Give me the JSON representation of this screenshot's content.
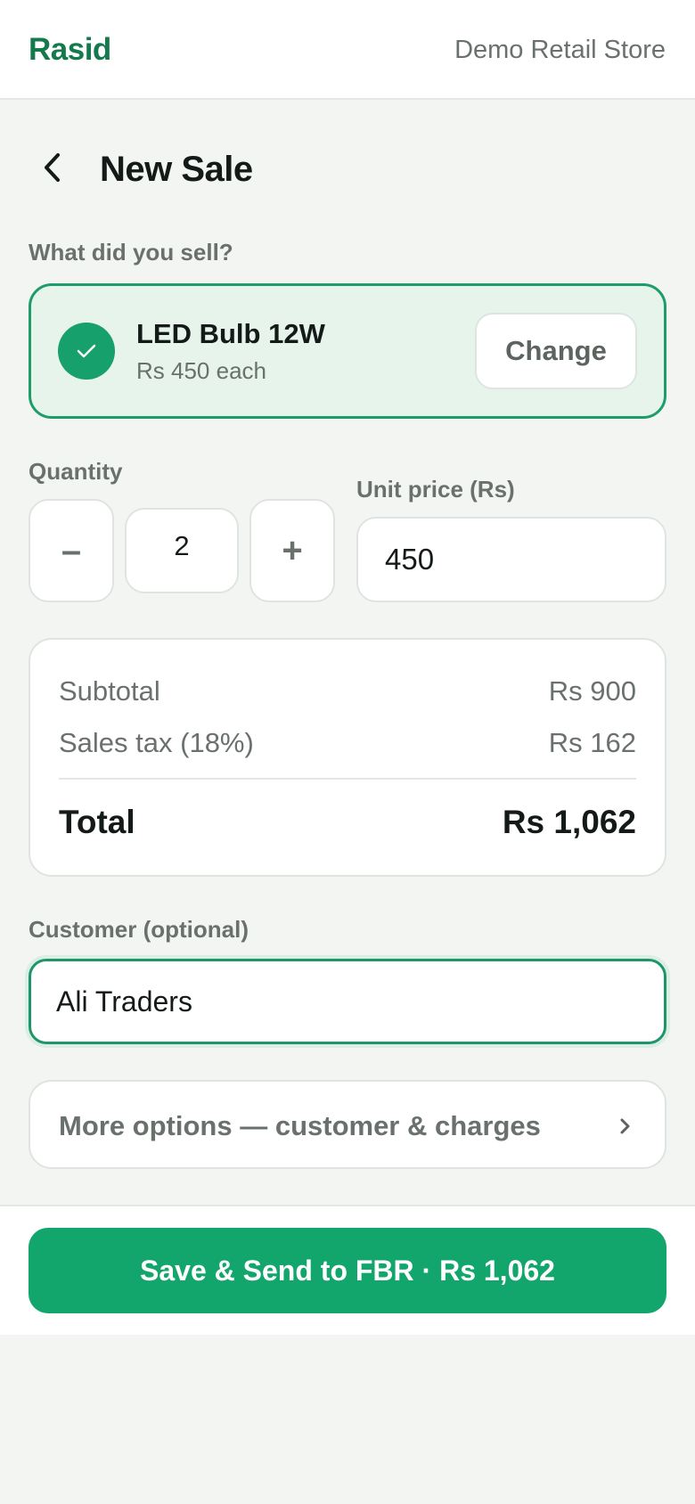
{
  "header": {
    "brand": "Rasid",
    "store": "Demo Retail Store"
  },
  "page": {
    "title": "New Sale"
  },
  "product_section": {
    "label": "What did you sell?",
    "name": "LED Bulb 12W",
    "price_each": "Rs 450 each",
    "change_label": "Change"
  },
  "quantity": {
    "label": "Quantity",
    "minus": "–",
    "value": "2",
    "plus": "+"
  },
  "unit_price": {
    "label": "Unit price (Rs)",
    "value": "450"
  },
  "summary": {
    "subtotal_label": "Subtotal",
    "subtotal_value": "Rs 900",
    "tax_label": "Sales tax (18%)",
    "tax_value": "Rs 162",
    "total_label": "Total",
    "total_value": "Rs 1,062"
  },
  "customer": {
    "label": "Customer (optional)",
    "value": "Ali Traders"
  },
  "more_options": {
    "label": "More options — customer & charges"
  },
  "footer": {
    "save_label": "Save & Send to FBR · Rs 1,062"
  },
  "colors": {
    "brand": "#147a4e",
    "accent": "#12a56c",
    "selected_bg": "#e6f4ec"
  },
  "icons": {
    "back": "chevron-left-icon",
    "check": "check-icon",
    "more": "chevron-right-icon"
  }
}
